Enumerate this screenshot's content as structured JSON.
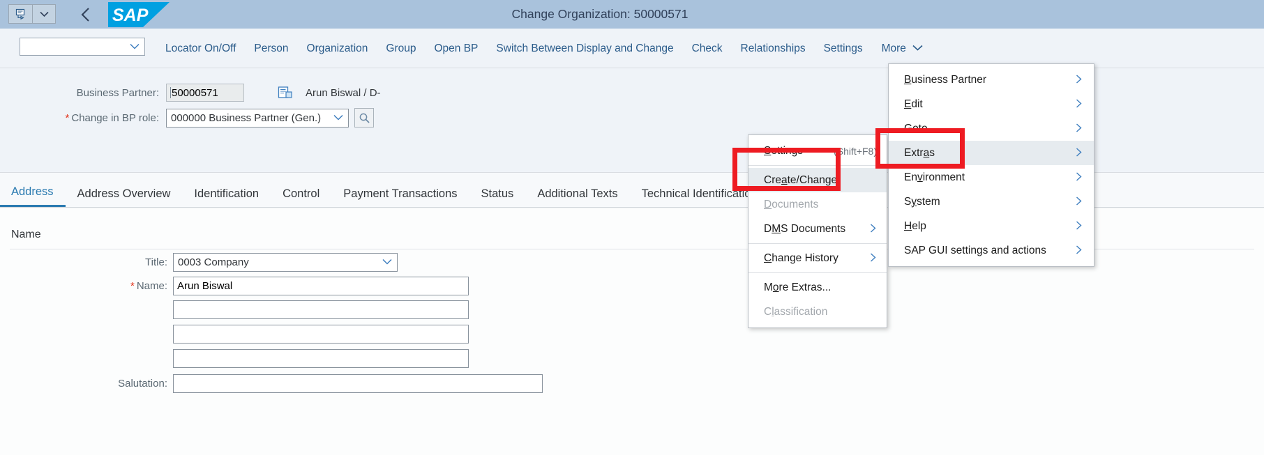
{
  "titlebar": {
    "title": "Change Organization: 50000571",
    "logo_text": "SAP",
    "back_icon": "back-chevron-icon",
    "sys_icon": "command-field-icon",
    "sys_dropdown_icon": "chevron-down-icon"
  },
  "toolbar": {
    "select_value": "",
    "select_icon": "chevron-down-icon",
    "items": [
      {
        "label": "Locator On/Off"
      },
      {
        "label": "Person"
      },
      {
        "label": "Organization"
      },
      {
        "label": "Group"
      },
      {
        "label": "Open BP"
      },
      {
        "label": "Switch Between Display and Change"
      },
      {
        "label": "Check"
      },
      {
        "label": "Relationships"
      },
      {
        "label": "Settings"
      }
    ],
    "more_label": "More",
    "more_icon": "chevron-down-icon"
  },
  "header_form": {
    "bp_label": "Business Partner:",
    "bp_value": "50000571",
    "bp_doc_icon": "document-partner-icon",
    "bp_person": "Arun Biswal / D-",
    "role_label": "Change in BP role:",
    "role_required": "*",
    "role_value": "000000 Business Partner (Gen.)",
    "role_chevron": "chevron-down-icon",
    "role_search_icon": "search-icon"
  },
  "tabs": [
    {
      "label": "Address",
      "active": true
    },
    {
      "label": "Address Overview",
      "active": false
    },
    {
      "label": "Identification",
      "active": false
    },
    {
      "label": "Control",
      "active": false
    },
    {
      "label": "Payment Transactions",
      "active": false
    },
    {
      "label": "Status",
      "active": false
    },
    {
      "label": "Additional Texts",
      "active": false
    },
    {
      "label": "Technical Identification",
      "active": false
    }
  ],
  "content": {
    "section_title": "Name",
    "title_label": "Title:",
    "title_value": "0003 Company",
    "title_chevron": "chevron-down-icon",
    "name_label": "Name:",
    "name_required": "*",
    "name_value": "Arun Biswal",
    "name_line2": "",
    "name_line3": "",
    "name_line4": "",
    "salutation_label": "Salutation:",
    "salutation_value": ""
  },
  "menu_left": {
    "items": [
      {
        "label": "Settings",
        "shortcut": "(Shift+F8)",
        "accel": "S",
        "state": "normal",
        "submenu": false
      },
      {
        "label": "Create/Change",
        "shortcut": "",
        "accel": "a",
        "state": "selected",
        "submenu": false
      },
      {
        "label": "Documents",
        "shortcut": "",
        "accel": "D",
        "state": "disabled",
        "submenu": false
      },
      {
        "label": "DMS Documents",
        "shortcut": "",
        "accel": "M",
        "state": "normal",
        "submenu": true
      },
      {
        "label": "Change History",
        "shortcut": "",
        "accel": "C",
        "state": "normal",
        "submenu": true
      },
      {
        "label": "More Extras...",
        "shortcut": "",
        "accel": "o",
        "state": "normal",
        "submenu": false
      },
      {
        "label": "Classification",
        "shortcut": "",
        "accel": "l",
        "state": "disabled",
        "submenu": false
      }
    ]
  },
  "menu_right": {
    "items": [
      {
        "label": "Business Partner",
        "accel": "B",
        "state": "normal",
        "submenu": true
      },
      {
        "label": "Edit",
        "accel": "E",
        "state": "normal",
        "submenu": true
      },
      {
        "label": "Goto",
        "accel": "G",
        "state": "normal",
        "submenu": true
      },
      {
        "label": "Extras",
        "accel": "a",
        "state": "selected",
        "submenu": true
      },
      {
        "label": "Environment",
        "accel": "v",
        "state": "normal",
        "submenu": true
      },
      {
        "label": "System",
        "accel": "y",
        "state": "normal",
        "submenu": true
      },
      {
        "label": "Help",
        "accel": "H",
        "state": "normal",
        "submenu": true
      },
      {
        "label": "SAP GUI settings and actions",
        "accel": "",
        "state": "normal",
        "submenu": true
      }
    ]
  },
  "annotations": {
    "highlight_color": "#ee1b22",
    "boxes": [
      {
        "name": "create-change-highlight"
      },
      {
        "name": "extras-highlight"
      }
    ]
  }
}
